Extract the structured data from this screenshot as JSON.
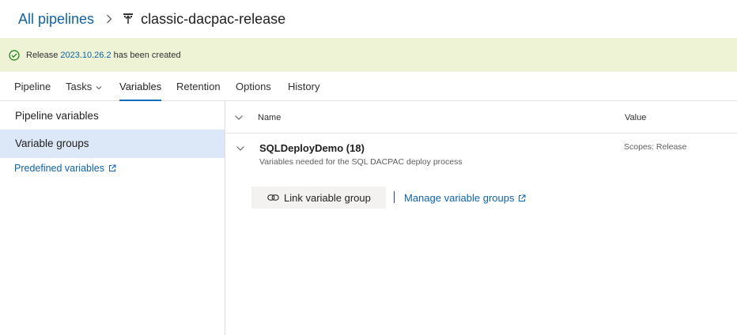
{
  "breadcrumb": {
    "all_pipelines": "All pipelines",
    "title": "classic-dacpac-release"
  },
  "banner": {
    "prefix": "Release",
    "release_link": "2023.10.26.2",
    "suffix": "has been created",
    "icon": "check-circle-icon"
  },
  "tabs": [
    {
      "label": "Pipeline"
    },
    {
      "label": "Tasks"
    },
    {
      "label": "Variables"
    },
    {
      "label": "Retention"
    },
    {
      "label": "Options"
    },
    {
      "label": "History"
    }
  ],
  "left_nav": {
    "pipeline_variables": "Pipeline variables",
    "variable_groups": "Variable groups",
    "predefined_variables": "Predefined variables"
  },
  "table": {
    "col_name": "Name",
    "col_value": "Value"
  },
  "group": {
    "name": "SQLDeployDemo (18)",
    "description": "Variables needed for the SQL DACPAC deploy process",
    "scope": "Scopes: Release"
  },
  "actions": {
    "link_variable_group": "Link variable group",
    "manage_variable_groups": "Manage variable groups"
  },
  "colors": {
    "accent": "#0f6cbd",
    "link": "#0e63a8",
    "banner_bg": "#eef3d6",
    "success": "#107c10",
    "selected_bg": "#dce8f7"
  }
}
